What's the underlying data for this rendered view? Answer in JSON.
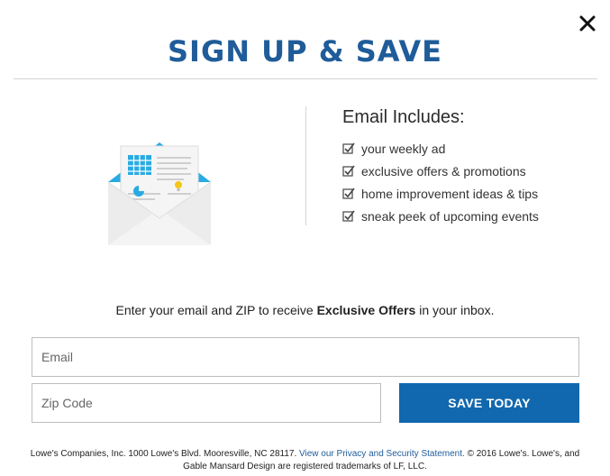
{
  "header": {
    "title": "SIGN UP & SAVE"
  },
  "includes": {
    "title": "Email Includes:",
    "items": [
      "your weekly ad",
      "exclusive offers & promotions",
      "home improvement ideas & tips",
      "sneak peek of upcoming events"
    ]
  },
  "prompt": {
    "before": "Enter your email and ZIP to receive ",
    "bold": "Exclusive Offers",
    "after": " in your inbox."
  },
  "form": {
    "email_placeholder": "Email",
    "email_value": "",
    "zip_placeholder": "Zip Code",
    "zip_value": "",
    "submit_label": "SAVE TODAY"
  },
  "footer": {
    "text_before": "Lowe's Companies, Inc. 1000 Lowe's Blvd. Mooresville, NC 28117. ",
    "link_text": "View our Privacy and Security Statement.",
    "text_after": " © 2016 Lowe's. Lowe's, and Gable Mansard Design are registered trademarks of LF, LLC."
  },
  "icons": {
    "close": "close-icon",
    "illustration": "envelope-newsletter-icon",
    "check": "checkbox-checked-icon"
  },
  "colors": {
    "title": "#1f5c99",
    "button": "#1268ae",
    "illustration_accent": "#29abe2"
  }
}
